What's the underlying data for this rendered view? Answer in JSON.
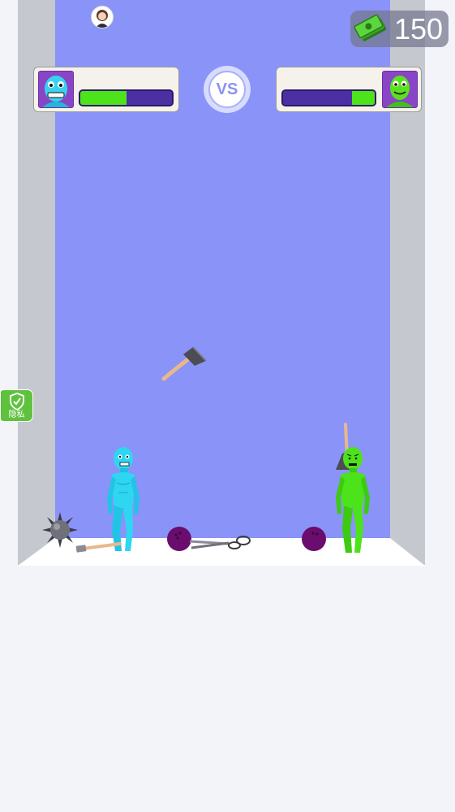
{
  "hud": {
    "currency": {
      "amount": "150",
      "icon": "cash-stack-icon"
    },
    "vs_label": "VS",
    "player": {
      "health_fraction": 0.5,
      "portrait": "blue-fighter-portrait"
    },
    "opponent": {
      "health_fraction": 0.25,
      "portrait": "green-fighter-portrait"
    }
  },
  "privacy_badge": {
    "label": "隐私",
    "icon": "shield-check-icon"
  },
  "colors": {
    "back_wall": "#8a93f8",
    "side_wall": "#c5c8cf",
    "floor": "#ffffff",
    "health_fill": "#4de31a",
    "health_track": "#4d2fa4",
    "player": "#2fd6f2",
    "opponent": "#4de31a"
  },
  "floor_items": [
    "spiked-mace",
    "hammer",
    "bowling-ball",
    "scissors",
    "bowling-ball"
  ],
  "airborne_item": "axe",
  "opponent_weapon": "axe"
}
